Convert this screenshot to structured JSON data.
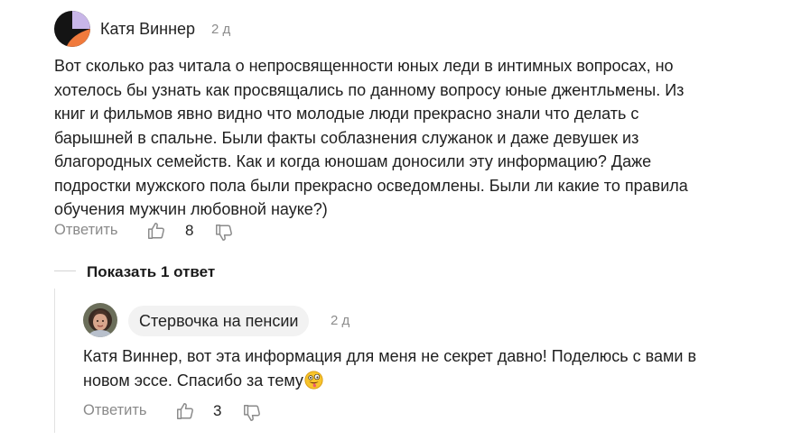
{
  "comment": {
    "author": "Катя Виннер",
    "time": "2 д",
    "text": "Вот сколько раз читала о непросвященности юных леди в интимных вопросах, но\nхотелось бы узнать как просвящались по данному вопросу юные джентльмены. Из\nкниг и фильмов явно видно что молодые люди прекрасно знали что делать с\nбарышней в спальне. Были факты соблазнения служанок и даже девушек из\nблагородных семейств. Как и когда юношам доносили эту информацию? Даже\nподростки мужского пола были прекрасно осведомлены. Были ли какие то правила\nобучения мужчин любовной науке?)",
    "reply_label": "Ответить",
    "likes": "8",
    "like_icon": "thumbs-up-icon",
    "dislike_icon": "thumbs-down-icon"
  },
  "show_replies_label": "Показать 1 ответ",
  "reply": {
    "author": "Стервочка на пенсии",
    "time": "2 д",
    "text": "Катя Виннер, вот эта информация для меня не секрет давно! Поделюсь с вами в\nновом эссе. Спасибо за тему",
    "emoji": "zany-face-emoji",
    "reply_label": "Ответить",
    "likes": "3"
  },
  "colors": {
    "muted": "#8a8a8a",
    "pill_bg": "#f2f2f2",
    "avatar_orange": "#f07a3c",
    "avatar_dark": "#141414",
    "avatar_lilac": "#c8b6e8"
  }
}
